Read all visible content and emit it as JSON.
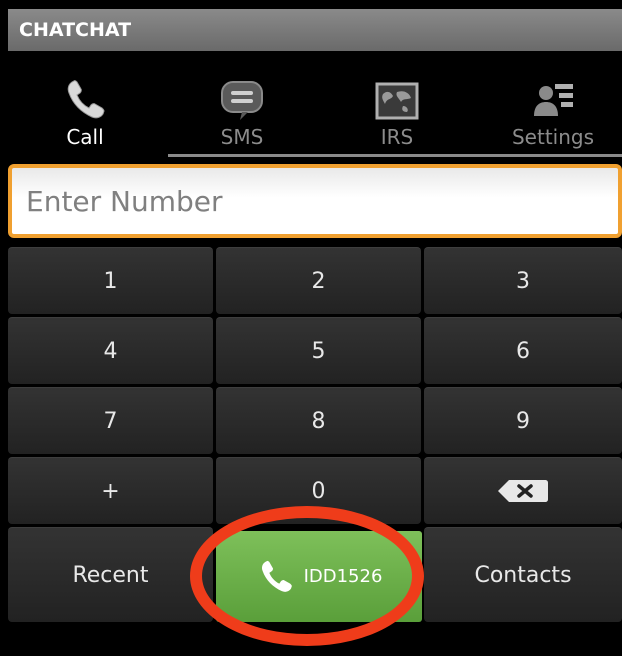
{
  "app": {
    "title": "CHATCHAT"
  },
  "tabs": [
    {
      "label": "Call",
      "icon": "phone-icon",
      "active": true
    },
    {
      "label": "SMS",
      "icon": "chat-bubble-icon",
      "active": false
    },
    {
      "label": "IRS",
      "icon": "world-map-icon",
      "active": false
    },
    {
      "label": "Settings",
      "icon": "contact-list-icon",
      "active": false
    }
  ],
  "input": {
    "placeholder": "Enter Number",
    "value": ""
  },
  "keypad": {
    "keys": [
      "1",
      "2",
      "3",
      "4",
      "5",
      "6",
      "7",
      "8",
      "9",
      "+",
      "0"
    ],
    "backspace_icon": "backspace-icon"
  },
  "actions": {
    "recent_label": "Recent",
    "call_label": "IDD1526",
    "contacts_label": "Contacts"
  },
  "colors": {
    "accent_orange": "#f0a030",
    "call_green": "#6aae48",
    "annotation_red": "#ef3c1a",
    "titlebar_gray": "#7a7a7a"
  }
}
